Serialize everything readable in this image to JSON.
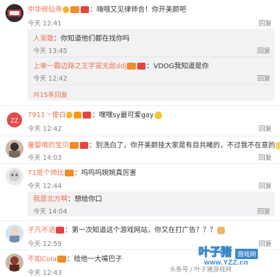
{
  "comments": [
    {
      "user": "中华修仙帝",
      "text": "：嗨哦又见律师合！你开美颜吧",
      "time": "今天 12:41",
      "reply": "回复",
      "thread": [
        {
          "user": "人渐散",
          "text": "：你知道他们都在找你吗",
          "time": "今天 13:45",
          "reply": "回复"
        },
        {
          "user": "上单一霸边路之王宇宙无敌ddj",
          "text": "：VDOG我知道是你",
          "time": "今天 12:42",
          "reply": "回复"
        }
      ],
      "more": "共15条回复"
    },
    {
      "user": "7911丶傻白",
      "text": "：嘿嘿sy最可爱gay",
      "time": "今天 12:42",
      "reply": "回复"
    },
    {
      "user": "童婴嘀的宝贝",
      "text": "：别洗白了，你开美颜挂大家是有目共睹的，不过我不在意的",
      "time": "今天 14:03",
      "reply": "回复"
    },
    {
      "user": "71是个帅比",
      "text": "：呜呜呜婉婉真厉害",
      "time": "今天 12:44",
      "reply": "回复",
      "thread": [
        {
          "user": "我是北方啊",
          "text": "：想给你口",
          "time": "今天 14:04",
          "reply": "回复"
        }
      ]
    },
    {
      "user": "子凡不语",
      "text": "：第一次知道这个游戏网站，你又在打广告？？？",
      "time": "今天 12:59",
      "reply": "回复"
    },
    {
      "user": "不如Cola",
      "text": "：给他一大嘴巴子",
      "time": "今天 12:43",
      "reply": ""
    }
  ],
  "watermark": {
    "site": "叶子猪",
    "tag": "游戏网",
    "url": "www.YZZ.cn",
    "credit": "头条号 / 叶子猪游戏网"
  }
}
